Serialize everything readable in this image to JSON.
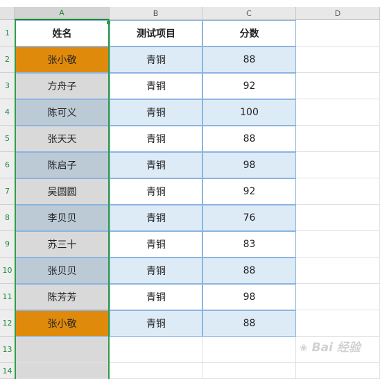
{
  "columns": [
    "A",
    "B",
    "C",
    "D"
  ],
  "rows": [
    "1",
    "2",
    "3",
    "4",
    "5",
    "6",
    "7",
    "8",
    "9",
    "10",
    "11",
    "12",
    "13",
    "14"
  ],
  "header": {
    "name": "姓名",
    "item": "测试项目",
    "score": "分数"
  },
  "records": [
    {
      "name": "张小敬",
      "item": "青铜",
      "score": "88"
    },
    {
      "name": "方舟子",
      "item": "青铜",
      "score": "92"
    },
    {
      "name": "陈可义",
      "item": "青铜",
      "score": "100"
    },
    {
      "name": "张天天",
      "item": "青铜",
      "score": "88"
    },
    {
      "name": "陈启子",
      "item": "青铜",
      "score": "98"
    },
    {
      "name": "吴圆圆",
      "item": "青铜",
      "score": "92"
    },
    {
      "name": "李贝贝",
      "item": "青铜",
      "score": "76"
    },
    {
      "name": "苏三十",
      "item": "青铜",
      "score": "83"
    },
    {
      "name": "张贝贝",
      "item": "青铜",
      "score": "88"
    },
    {
      "name": "陈芳芳",
      "item": "青铜",
      "score": "98"
    },
    {
      "name": "张小敬",
      "item": "青铜",
      "score": "88"
    }
  ],
  "colors": {
    "header_bg": "#ffffff",
    "name_orange": "#e08a0b",
    "name_grey": "#d9d9d9",
    "name_bluegrey": "#bccad6",
    "band_blue": "#ddebf7",
    "selection_green": "#2e9e46"
  },
  "name_fill": [
    "orange",
    "grey",
    "bluegrey",
    "grey",
    "bluegrey",
    "grey",
    "bluegrey",
    "grey",
    "bluegrey",
    "grey",
    "orange"
  ],
  "selected_column": "A",
  "watermark": {
    "text": "Bai 经验",
    "icon": "baidu-paw-icon"
  }
}
